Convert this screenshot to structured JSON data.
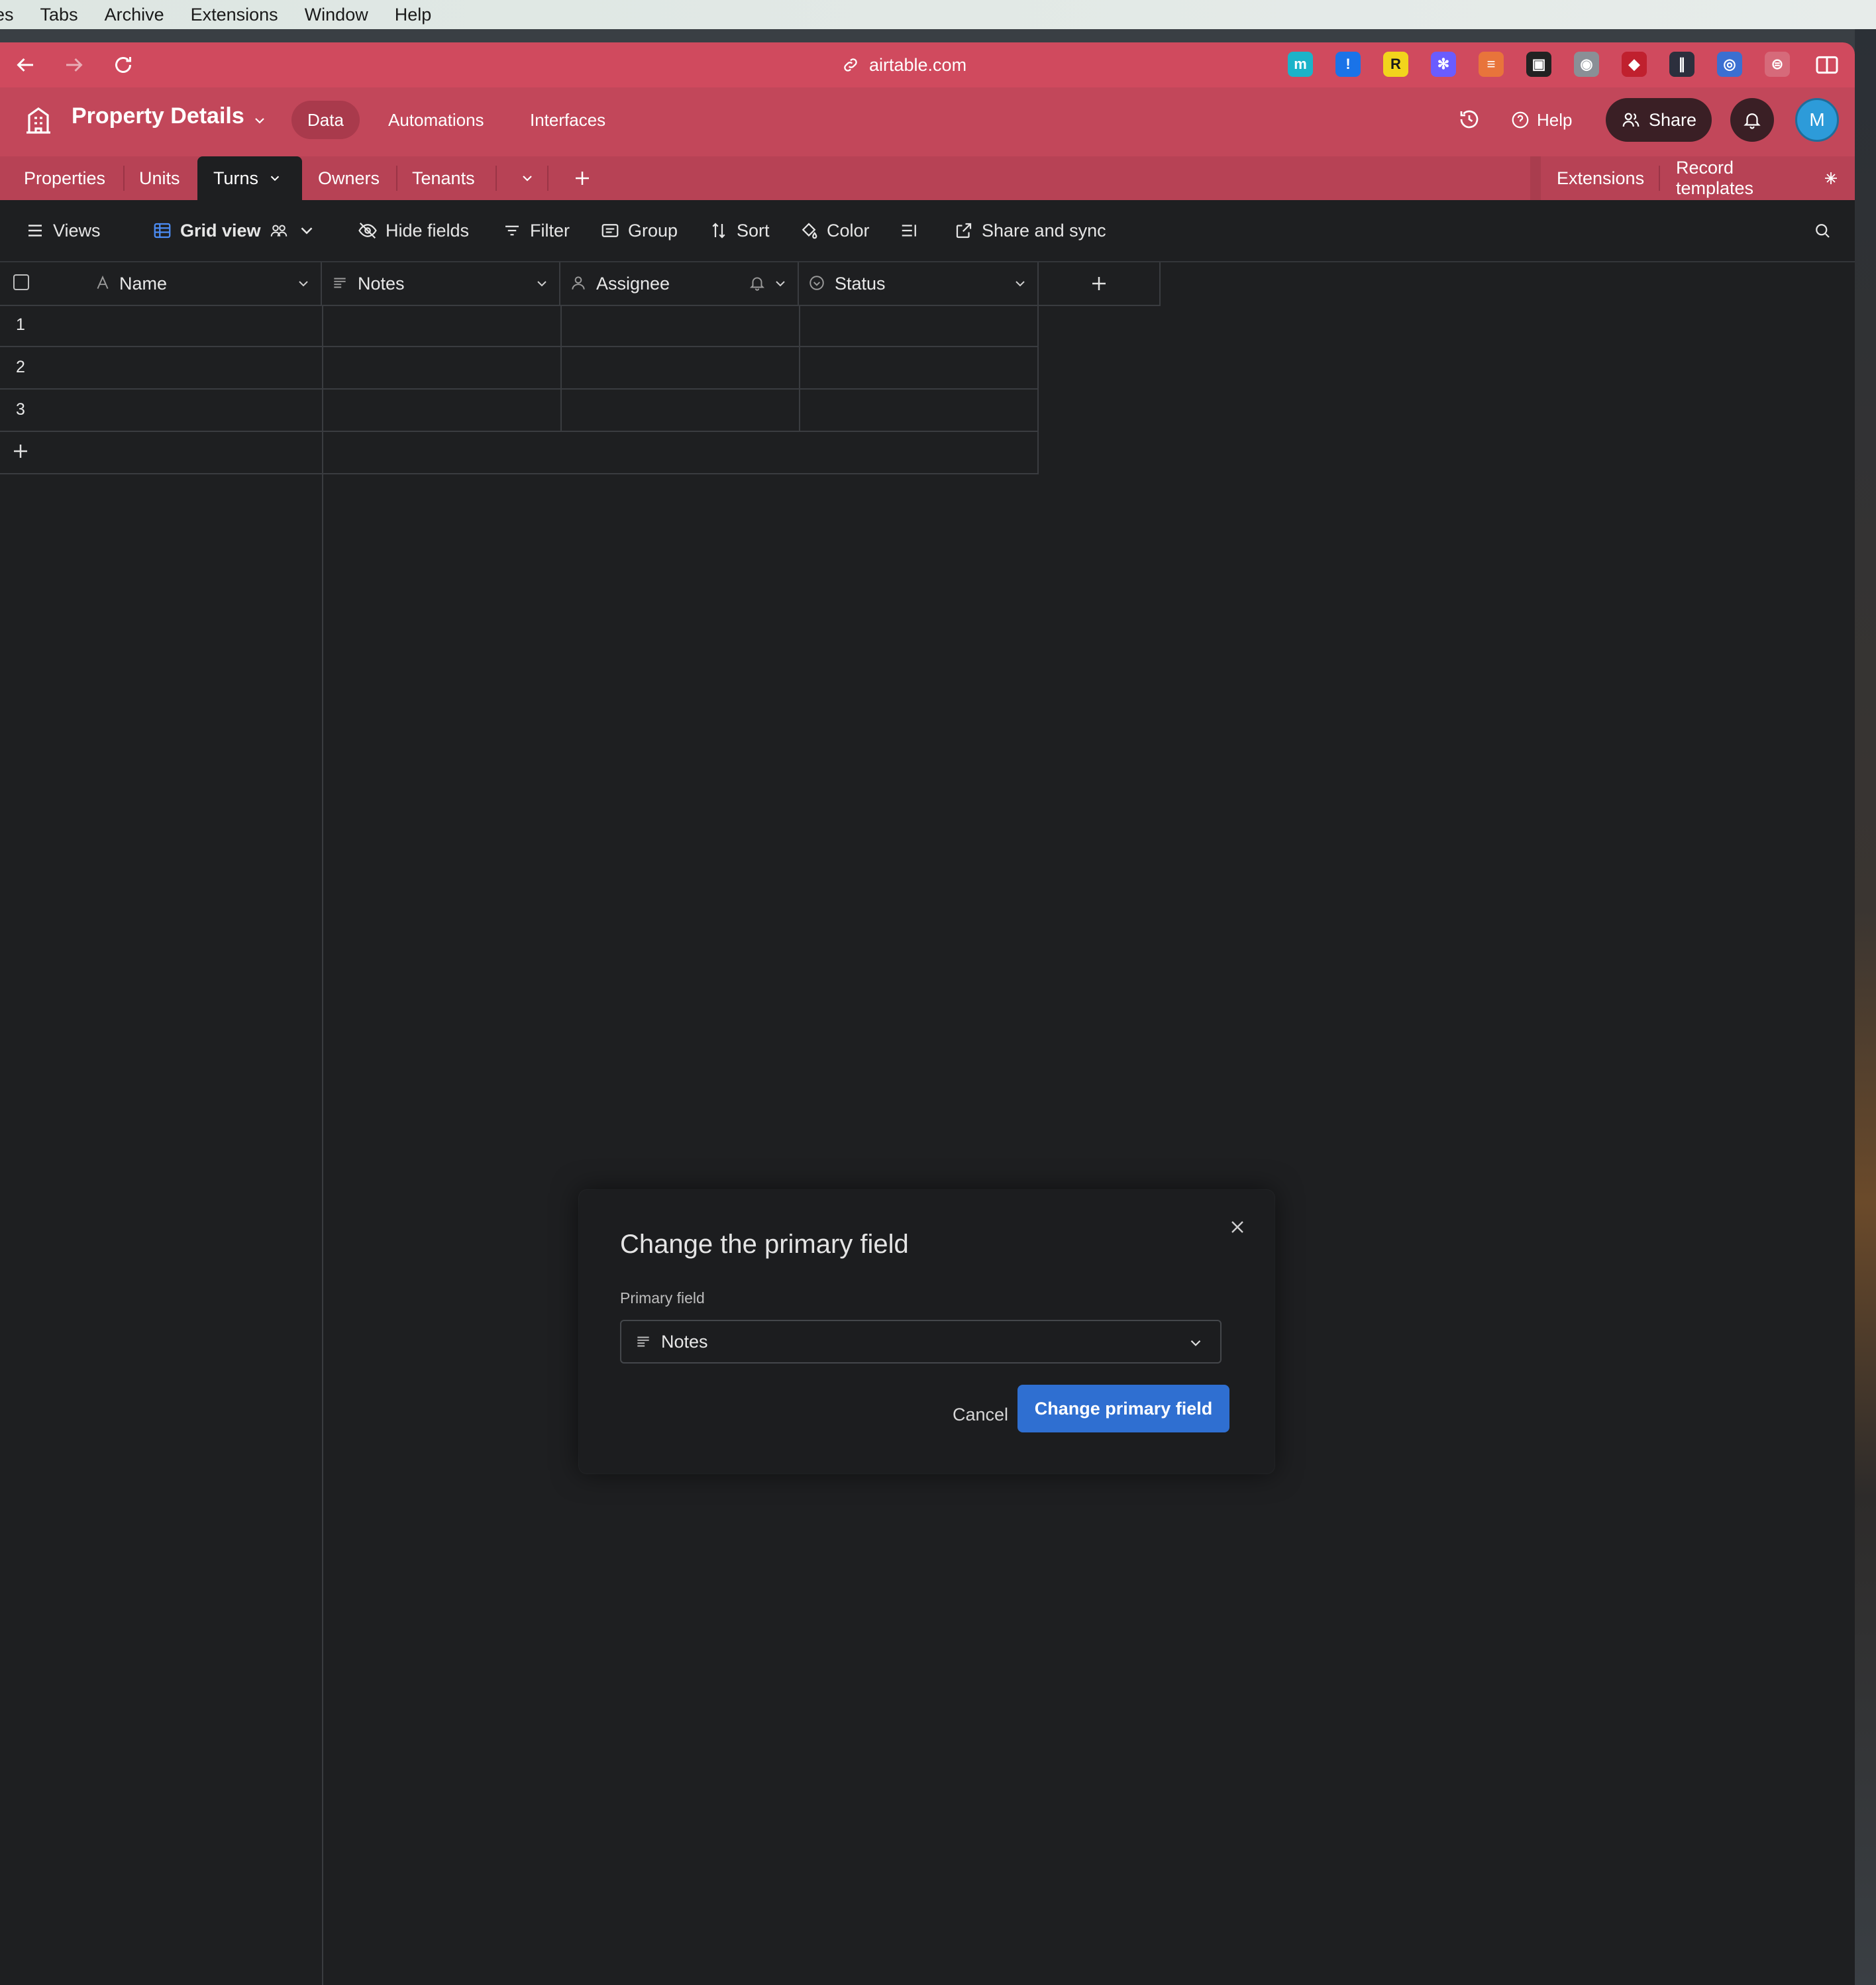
{
  "menubar": {
    "items": [
      "es",
      "Tabs",
      "Archive",
      "Extensions",
      "Window",
      "Help"
    ]
  },
  "browser": {
    "url": "airtable.com",
    "extensions": [
      {
        "name": "m-extension-icon",
        "glyph": "m",
        "color": "#1bb3c9"
      },
      {
        "name": "password-manager-icon",
        "glyph": "!",
        "color": "#1a73e8"
      },
      {
        "name": "r-extension-icon",
        "glyph": "R",
        "color": "#f2d41c"
      },
      {
        "name": "gear-extension-icon",
        "glyph": "✻",
        "color": "#6a5cff"
      },
      {
        "name": "todoist-icon",
        "glyph": "≡",
        "color": "#e8743b"
      },
      {
        "name": "image-extension-icon",
        "glyph": "▣",
        "color": "#222222"
      },
      {
        "name": "camera-extension-icon",
        "glyph": "◉",
        "color": "#8a8f96"
      },
      {
        "name": "shield-extension-icon",
        "glyph": "◆",
        "color": "#c0202e"
      },
      {
        "name": "pen-extension-icon",
        "glyph": "∥",
        "color": "#2c2f3d"
      },
      {
        "name": "target-extension-icon",
        "glyph": "◎",
        "color": "#3b6fd1"
      },
      {
        "name": "settings-extension-icon",
        "glyph": "⊜",
        "color": "#d66a7a"
      }
    ]
  },
  "header": {
    "base_name": "Property Details",
    "tabs": {
      "data": "Data",
      "automations": "Automations",
      "interfaces": "Interfaces"
    },
    "help": "Help",
    "share": "Share",
    "avatar": "M"
  },
  "table_tabs": {
    "items": [
      "Properties",
      "Units",
      "Turns",
      "Owners",
      "Tenants"
    ],
    "active": "Turns",
    "extensions": "Extensions",
    "record_templates": "Record templates"
  },
  "toolbar": {
    "views": "Views",
    "grid_view": "Grid view",
    "hide_fields": "Hide fields",
    "filter": "Filter",
    "group": "Group",
    "sort": "Sort",
    "color": "Color",
    "share_sync": "Share and sync"
  },
  "grid": {
    "columns": [
      "Name",
      "Notes",
      "Assignee",
      "Status"
    ],
    "rows": [
      "1",
      "2",
      "3"
    ]
  },
  "modal": {
    "title": "Change the primary field",
    "field_label": "Primary field",
    "selected_field": "Notes",
    "cancel": "Cancel",
    "confirm": "Change primary field"
  },
  "colors": {
    "browser_bar": "#d04a5e",
    "app_header": "#c2475a",
    "grid_background": "#1e1f21",
    "primary_button": "#2f6fd1"
  }
}
